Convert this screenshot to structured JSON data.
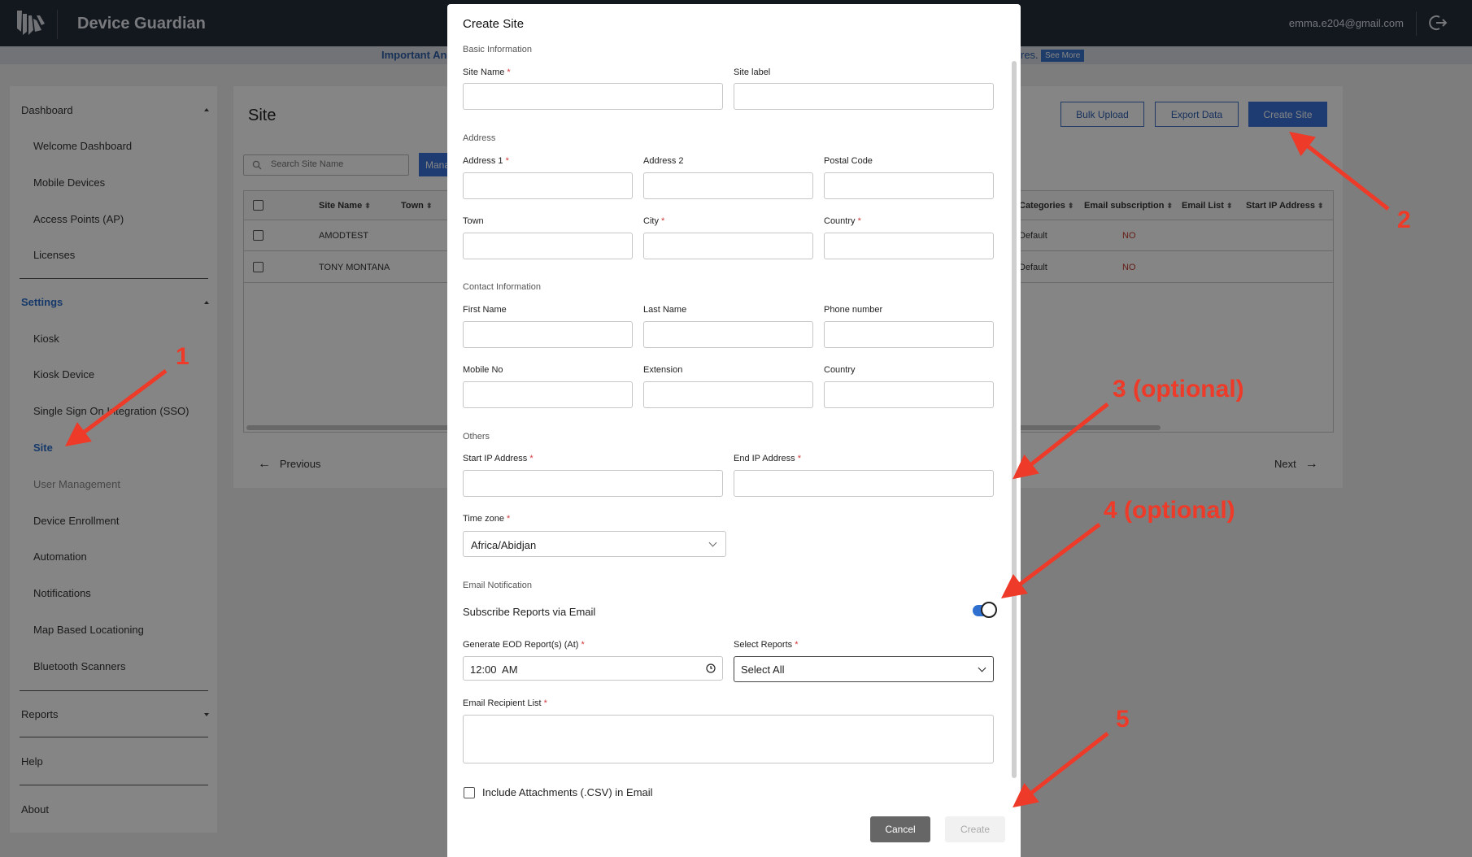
{
  "app": {
    "title": "Device Guardian",
    "user_email": "emma.e204@gmail.com"
  },
  "announcement": {
    "left_text": "Important An",
    "right_text": "res.",
    "see_more": "See More"
  },
  "sidebar": {
    "dashboard": {
      "label": "Dashboard",
      "items": [
        "Welcome Dashboard",
        "Mobile Devices",
        "Access Points (AP)",
        "Licenses"
      ]
    },
    "settings": {
      "label": "Settings",
      "items": [
        "Kiosk",
        "Kiosk Device",
        "Single Sign On Integration (SSO)",
        "Site",
        "User Management",
        "Device Enrollment",
        "Automation",
        "Notifications",
        "Map Based Locationing",
        "Bluetooth Scanners"
      ]
    },
    "reports": "Reports",
    "help": "Help",
    "about": "About"
  },
  "page": {
    "title": "Site",
    "buttons": {
      "bulk_upload": "Bulk Upload",
      "export_data": "Export Data",
      "create_site": "Create Site"
    },
    "search_placeholder": "Search Site Name",
    "manage_label": "Mana",
    "table": {
      "columns_left": [
        "Site Name",
        "Town"
      ],
      "columns_right": [
        "Categories",
        "Email subscription",
        "Email List",
        "Start IP Address"
      ],
      "rows": [
        {
          "site_name": "AMODTEST",
          "category": "Default",
          "email_subscription": "NO"
        },
        {
          "site_name": "TONY MONTANA",
          "category": "Default",
          "email_subscription": "NO"
        }
      ]
    },
    "pagination": {
      "previous": "Previous",
      "next": "Next"
    }
  },
  "modal": {
    "title": "Create Site",
    "sections": {
      "basic": "Basic Information",
      "address": "Address",
      "contact": "Contact Information",
      "others": "Others",
      "email": "Email Notification"
    },
    "fields": {
      "site_name": "Site Name",
      "site_label": "Site label",
      "address1": "Address 1",
      "address2": "Address 2",
      "postal_code": "Postal Code",
      "town": "Town",
      "city": "City",
      "country": "Country",
      "first_name": "First Name",
      "last_name": "Last Name",
      "phone": "Phone number",
      "mobile": "Mobile No",
      "extension": "Extension",
      "contact_country": "Country",
      "start_ip": "Start IP Address",
      "end_ip": "End IP Address",
      "time_zone": "Time zone",
      "generate_eod": "Generate EOD Report(s) (At)",
      "select_reports": "Select Reports",
      "recipient_list": "Email Recipient List"
    },
    "required_mark": "*",
    "time_zone_value": "Africa/Abidjan",
    "subscribe_label": "Subscribe Reports via Email",
    "subscribe_on": true,
    "eod_time": "12:00  AM",
    "select_reports_value": "Select All",
    "include_attachments": "Include Attachments (.CSV) in Email",
    "cancel": "Cancel",
    "create": "Create"
  },
  "annotations": [
    "1",
    "2",
    "3 (optional)",
    "4 (optional)",
    "5"
  ],
  "colors": {
    "topbar": "#262e3d",
    "accent": "#3b73d8",
    "annotation": "#ee3a28"
  }
}
